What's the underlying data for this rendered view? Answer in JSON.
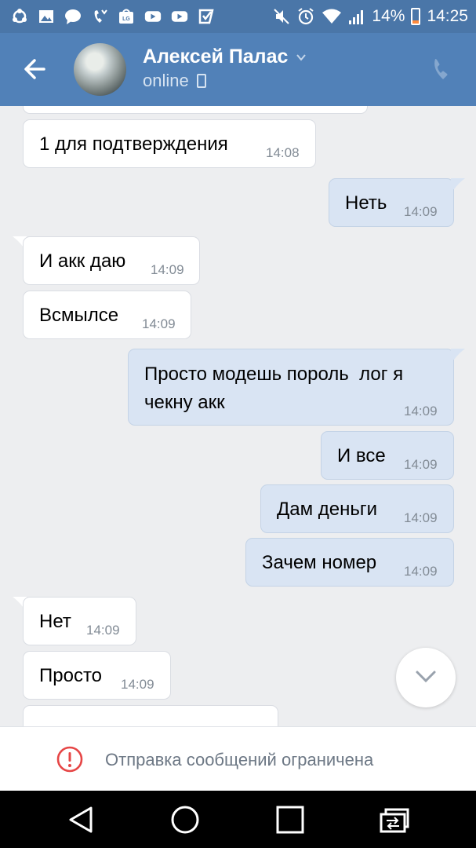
{
  "statusbar": {
    "battery_text": "14%",
    "time": "14:25",
    "notification_icons": [
      "sync-icon",
      "gallery-icon",
      "chat-icon",
      "missed-call-icon",
      "lg-app-icon",
      "youtube-icon",
      "youtube-icon",
      "check-app-icon"
    ],
    "system_icons": [
      "mute-icon",
      "alarm-icon",
      "wifi-icon",
      "signal-icon",
      "battery-icon"
    ]
  },
  "header": {
    "contact_name": "Алексей Палас",
    "status": "online",
    "accent_color": "#5181b8"
  },
  "messages": [
    {
      "dir": "in",
      "text": "1 для подтверждения",
      "time": "14:08"
    },
    {
      "dir": "out",
      "text": "Неть",
      "time": "14:09"
    },
    {
      "dir": "in",
      "text": "И акк даю",
      "time": "14:09"
    },
    {
      "dir": "in",
      "text": "Всмылсе",
      "time": "14:09"
    },
    {
      "dir": "out",
      "text_line1": "Просто модешь пороль  лог я",
      "text_line2": "чекну акк",
      "time": "14:09"
    },
    {
      "dir": "out",
      "text": "И все",
      "time": "14:09"
    },
    {
      "dir": "out",
      "text": "Дам деньги",
      "time": "14:09"
    },
    {
      "dir": "out",
      "text": "Зачем номер",
      "time": "14:09"
    },
    {
      "dir": "in",
      "text": "Нет",
      "time": "14:09"
    },
    {
      "dir": "in",
      "text": "Просто",
      "time": "14:09"
    }
  ],
  "restriction": {
    "text": "Отправка сообщений ограничена",
    "icon": "warning-circle-icon",
    "color": "#e64646"
  },
  "navbar": {
    "buttons": [
      "back-triangle-icon",
      "home-circle-icon",
      "recents-square-icon",
      "dual-window-icon"
    ]
  }
}
